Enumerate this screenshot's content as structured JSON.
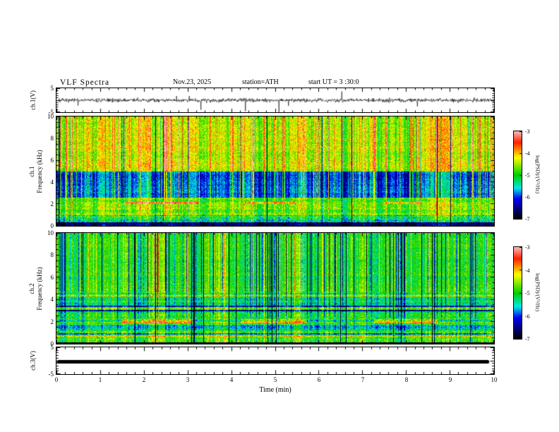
{
  "header": {
    "title": "VLF  Spectra",
    "date": "Nov.23, 2025",
    "station": "station=ATH",
    "start_ut": "start UT =  3 :30:0"
  },
  "xaxis": {
    "label": "Time (min)",
    "ticks": [
      0,
      1,
      2,
      3,
      4,
      5,
      6,
      7,
      8,
      9,
      10
    ],
    "range": [
      0,
      10
    ],
    "minor_step": 0.2
  },
  "colormap": {
    "stops": [
      {
        "t": 0.0,
        "c": "#000000"
      },
      {
        "t": 0.1,
        "c": "#00006e"
      },
      {
        "t": 0.225,
        "c": "#0000f0"
      },
      {
        "t": 0.35,
        "c": "#00e8e8"
      },
      {
        "t": 0.5,
        "c": "#00d000"
      },
      {
        "t": 0.7,
        "c": "#ffff00"
      },
      {
        "t": 0.8,
        "c": "#ff8000"
      },
      {
        "t": 0.875,
        "c": "#ff2000"
      },
      {
        "t": 1.0,
        "c": "#ffb6b6"
      }
    ]
  },
  "chart_data": [
    {
      "type": "line",
      "id": "ch1_wave",
      "ylabel": "ch.1(V)",
      "ylim": [
        -5,
        5
      ],
      "yticks": [
        5,
        -5
      ],
      "xlim_min": [
        0,
        10
      ],
      "noise_std": 0.4,
      "spike_prob": 0.012,
      "spike_amp": 4.5,
      "seed": 7,
      "description": "ch.1 time series: broadband noise around 0 V with impulsive sferic spikes reaching ±5 V"
    },
    {
      "type": "heatmap",
      "id": "ch1_spec",
      "ylabel": "ch.1\nFrequency (kHz)",
      "ylim": [
        0,
        10
      ],
      "yticks": [
        0,
        2,
        4,
        6,
        8,
        10
      ],
      "yminor": 0.5,
      "seed": 42,
      "neg_prob": 0.12,
      "pos_scale": 1.0,
      "bands": [
        {
          "f": [
            5.0,
            10
          ],
          "level": -4.55,
          "var": 0.35,
          "streak": 1.0,
          "stripe": 0.15
        },
        {
          "f": [
            2.55,
            5.0
          ],
          "level": -6.05,
          "var": 0.3,
          "streak": 1.3,
          "stripe": 0.2
        },
        {
          "f": [
            1.0,
            2.55
          ],
          "level": -4.7,
          "var": 0.35,
          "streak": 0.5,
          "stripe": 0.5
        },
        {
          "f": [
            0.35,
            1.0
          ],
          "level": -5.4,
          "var": 0.5,
          "streak": 0.4,
          "stripe": 0.9
        },
        {
          "f": [
            0.0,
            0.35
          ],
          "level": -6.7,
          "var": 0.35,
          "streak": 0.1,
          "stripe": 0.3
        }
      ],
      "events": [
        {
          "f": [
            1.98,
            2.22
          ],
          "t": [
            1.55,
            3.25
          ],
          "boost": 1.5
        },
        {
          "f": [
            1.98,
            2.22
          ],
          "t": [
            4.35,
            5.45
          ],
          "boost": 1.1
        },
        {
          "f": [
            1.98,
            2.22
          ],
          "t": [
            7.5,
            8.35
          ],
          "boost": 0.9
        }
      ],
      "darklines": [],
      "colorbar": {
        "label": "log(PSD)/(V²/Hz)",
        "ticks": [
          -3,
          -4,
          -5,
          -6,
          -7
        ],
        "lim": [
          -7,
          -3
        ]
      }
    },
    {
      "type": "heatmap",
      "id": "ch2_spec",
      "ylabel": "ch.2\nFrequency (kHz)",
      "ylim": [
        0,
        10
      ],
      "yticks": [
        0,
        2,
        4,
        6,
        8,
        10
      ],
      "yminor": 0.5,
      "seed": 1337,
      "neg_prob": 0.55,
      "pos_scale": 0.55,
      "bands": [
        {
          "f": [
            4.7,
            10
          ],
          "level": -4.85,
          "var": 0.3,
          "streak": 1.1,
          "stripe": 0.15
        },
        {
          "f": [
            2.4,
            4.7
          ],
          "level": -4.9,
          "var": 0.35,
          "streak": 0.7,
          "stripe": 0.55
        },
        {
          "f": [
            0.15,
            2.4
          ],
          "level": -4.75,
          "var": 0.4,
          "streak": 0.4,
          "stripe": 0.7
        },
        {
          "f": [
            0.0,
            0.15
          ],
          "level": -6.9,
          "var": 0.2,
          "streak": 0.0,
          "stripe": 0.0
        }
      ],
      "events": [
        {
          "f": [
            1.85,
            2.25
          ],
          "t": [
            1.5,
            3.1
          ],
          "boost": 1.4
        },
        {
          "f": [
            1.85,
            2.25
          ],
          "t": [
            4.2,
            5.7
          ],
          "boost": 1.2
        },
        {
          "f": [
            1.85,
            2.25
          ],
          "t": [
            7.25,
            8.7
          ],
          "boost": 1.3
        },
        {
          "f": [
            4.28,
            4.45
          ],
          "t": [
            0,
            10
          ],
          "boost": 1.0
        },
        {
          "f": [
            0.55,
            0.7
          ],
          "t": [
            0,
            10
          ],
          "boost": 0.8
        }
      ],
      "darklines": [
        3.0,
        3.35,
        0.9
      ],
      "colorbar": {
        "label": "log(PSD)/(V²/Hz)",
        "ticks": [
          -3,
          -4,
          -5,
          -6,
          -7
        ],
        "lim": [
          -7,
          -3
        ]
      }
    },
    {
      "type": "line",
      "id": "ch3_flat",
      "ylabel": "ch.3(V)",
      "ylim": [
        -5,
        5
      ],
      "yticks": [
        5,
        -5
      ],
      "flat_value": -0.4,
      "line_width": 5,
      "x_extent": [
        0,
        9.85
      ],
      "description": "ch.3 channel flat/saturated: constant thick black trace near 0 V"
    }
  ]
}
